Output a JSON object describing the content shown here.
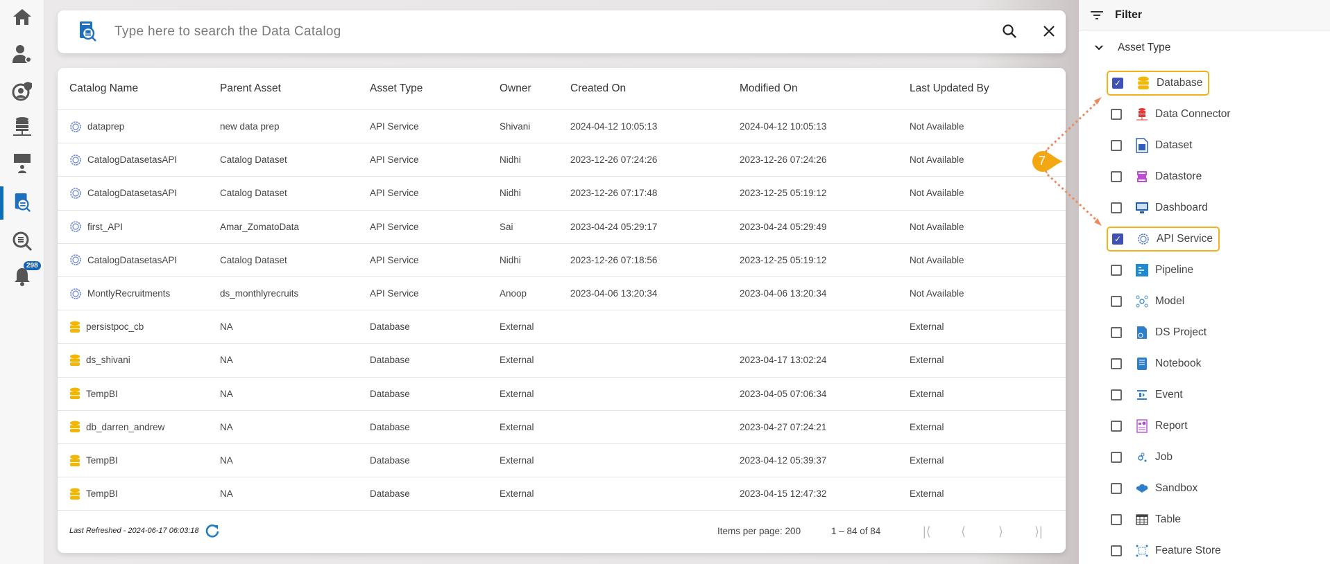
{
  "sidebar": {
    "items": [
      "home",
      "user-settings",
      "security",
      "data-connector",
      "data-science",
      "data-catalog",
      "data-search",
      "notifications"
    ],
    "active": "data-catalog",
    "notification_count": "298"
  },
  "search": {
    "placeholder": "Type here to search the Data Catalog"
  },
  "table": {
    "columns": [
      "Catalog Name",
      "Parent Asset",
      "Asset Type",
      "Owner",
      "Created On",
      "Modified On",
      "Last Updated By"
    ],
    "rows": [
      [
        "dataprep",
        "new data prep",
        "API Service",
        "Shivani",
        "2024-04-12 10:05:13",
        "2024-04-12 10:05:13",
        "Not Available"
      ],
      [
        "CatalogDatasetasAPI",
        "Catalog Dataset",
        "API Service",
        "Nidhi",
        "2023-12-26 07:24:26",
        "2023-12-26 07:24:26",
        "Not Available"
      ],
      [
        "CatalogDatasetasAPI",
        "Catalog Dataset",
        "API Service",
        "Nidhi",
        "2023-12-26 07:17:48",
        "2023-12-25 05:19:12",
        "Not Available"
      ],
      [
        "first_API",
        "Amar_ZomatoData",
        "API Service",
        "Sai",
        "2023-04-24 05:29:17",
        "2023-04-24 05:29:49",
        "Not Available"
      ],
      [
        "CatalogDatasetasAPI",
        "Catalog Dataset",
        "API Service",
        "Nidhi",
        "2023-12-26 07:18:56",
        "2023-12-25 05:19:12",
        "Not Available"
      ],
      [
        "MontlyRecruitments",
        "ds_monthlyrecruits",
        "API Service",
        "Anoop",
        "2023-04-06 13:20:34",
        "2023-04-06 13:20:34",
        "Not Available"
      ],
      [
        "persistpoc_cb",
        "NA",
        "Database",
        "External",
        "",
        "",
        "External"
      ],
      [
        "ds_shivani",
        "NA",
        "Database",
        "External",
        "",
        "2023-04-17 13:02:24",
        "External"
      ],
      [
        "TempBI",
        "NA",
        "Database",
        "External",
        "",
        "2023-04-05 07:06:34",
        "External"
      ],
      [
        "db_darren_andrew",
        "NA",
        "Database",
        "External",
        "",
        "2023-04-27 07:24:21",
        "External"
      ],
      [
        "TempBI",
        "NA",
        "Database",
        "External",
        "",
        "2023-04-12 05:39:37",
        "External"
      ],
      [
        "TempBI",
        "NA",
        "Database",
        "External",
        "",
        "2023-04-15 12:47:32",
        "External"
      ]
    ]
  },
  "footer": {
    "last_refreshed": "Last Refreshed - 2024-06-17 06:03:18",
    "items_per_page": "Items per page: 200",
    "range": "1 – 84 of 84"
  },
  "filter": {
    "title": "Filter",
    "section": "Asset Type",
    "items": [
      {
        "label": "Database",
        "checked": true,
        "icon": "database-icon",
        "color": "#f2b705"
      },
      {
        "label": "Data Connector",
        "checked": false,
        "icon": "data-connector-icon",
        "color": "#e53935"
      },
      {
        "label": "Dataset",
        "checked": false,
        "icon": "dataset-icon",
        "color": "#2d5fc4"
      },
      {
        "label": "Datastore",
        "checked": false,
        "icon": "datastore-icon",
        "color": "#c04ad6"
      },
      {
        "label": "Dashboard",
        "checked": false,
        "icon": "dashboard-icon",
        "color": "#1f5fae"
      },
      {
        "label": "API Service",
        "checked": true,
        "icon": "api-service-icon",
        "color": "#5b7fd0"
      },
      {
        "label": "Pipeline",
        "checked": false,
        "icon": "pipeline-icon",
        "color": "#1d8ad1"
      },
      {
        "label": "Model",
        "checked": false,
        "icon": "model-icon",
        "color": "#3d8fd1"
      },
      {
        "label": "DS Project",
        "checked": false,
        "icon": "ds-project-icon",
        "color": "#2f7fc8"
      },
      {
        "label": "Notebook",
        "checked": false,
        "icon": "notebook-icon",
        "color": "#2f7fc8"
      },
      {
        "label": "Event",
        "checked": false,
        "icon": "event-icon",
        "color": "#2f7fc8"
      },
      {
        "label": "Report",
        "checked": false,
        "icon": "report-icon",
        "color": "#b14fd1"
      },
      {
        "label": "Job",
        "checked": false,
        "icon": "job-icon",
        "color": "#2f7fc8"
      },
      {
        "label": "Sandbox",
        "checked": false,
        "icon": "sandbox-icon",
        "color": "#2f7fc8"
      },
      {
        "label": "Table",
        "checked": false,
        "icon": "table-icon",
        "color": "#444444"
      },
      {
        "label": "Feature Store",
        "checked": false,
        "icon": "feature-store-icon",
        "color": "#2f7fc8"
      }
    ]
  },
  "annotation": {
    "number": "7",
    "color": "#f3a712",
    "arrow_color": "#ee8a5f"
  }
}
